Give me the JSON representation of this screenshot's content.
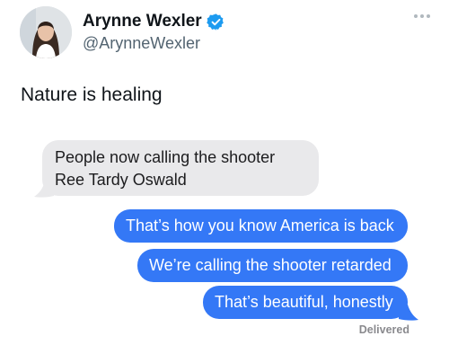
{
  "author": {
    "display_name": "Arynne Wexler",
    "handle": "@ArynneWexler",
    "verified_icon": "verified-badge-icon",
    "verified_color": "#1d9bf0"
  },
  "tweet": {
    "text": "Nature is healing"
  },
  "messages": {
    "received": [
      "People now calling the shooter Ree Tardy Oswald"
    ],
    "sent": [
      "That’s how you know America is back",
      "We’re calling the shooter retarded",
      "That’s beautiful, honestly"
    ],
    "status": "Delivered"
  },
  "colors": {
    "sent_bubble": "#3478f6",
    "received_bubble": "#e9e9eb",
    "text": "#0f1419",
    "secondary_text": "#536471"
  }
}
